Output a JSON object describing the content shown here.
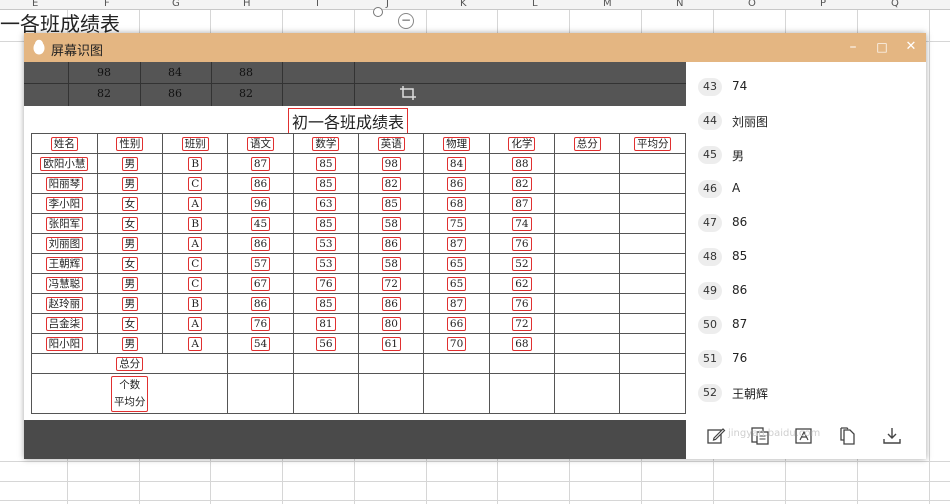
{
  "sheet": {
    "columns": [
      "E",
      "F",
      "G",
      "H",
      "I",
      "J",
      "K",
      "L",
      "M",
      "N",
      "O",
      "P",
      "Q"
    ],
    "title_partial": "一各班成绩表",
    "left_edge_values": [
      "数学",
      "85",
      "85",
      "63",
      "85",
      "53",
      "76",
      "85",
      "81",
      "56"
    ]
  },
  "window": {
    "title": "屏幕识图",
    "buttons": {
      "minimize": "–",
      "maximize": "□",
      "close": "✕"
    }
  },
  "strip": {
    "row1": [
      "98",
      "84",
      "88"
    ],
    "row2": [
      "82",
      "86",
      "82"
    ]
  },
  "doc": {
    "title": "初一各班成绩表",
    "headers": [
      "姓名",
      "性别",
      "班别",
      "语文",
      "数学",
      "英语",
      "物理",
      "化学",
      "总分",
      "平均分"
    ],
    "rows": [
      [
        "欧阳小慧",
        "男",
        "B",
        "87",
        "85",
        "98",
        "84",
        "88"
      ],
      [
        "阳丽琴",
        "男",
        "C",
        "86",
        "85",
        "82",
        "86",
        "82"
      ],
      [
        "李小阳",
        "女",
        "A",
        "96",
        "63",
        "85",
        "68",
        "87"
      ],
      [
        "张阳军",
        "女",
        "B",
        "45",
        "85",
        "58",
        "75",
        "74"
      ],
      [
        "刘丽图",
        "男",
        "A",
        "86",
        "53",
        "86",
        "87",
        "76"
      ],
      [
        "王朝辉",
        "女",
        "C",
        "57",
        "53",
        "58",
        "65",
        "52"
      ],
      [
        "冯慧聪",
        "男",
        "C",
        "67",
        "76",
        "72",
        "65",
        "62"
      ],
      [
        "赵玲丽",
        "男",
        "B",
        "86",
        "85",
        "86",
        "87",
        "76"
      ],
      [
        "吕金柒",
        "女",
        "A",
        "76",
        "81",
        "80",
        "66",
        "72"
      ],
      [
        "阳小阳",
        "男",
        "A",
        "54",
        "56",
        "61",
        "70",
        "68"
      ]
    ],
    "footer": {
      "total": "总分",
      "count": "个数",
      "average": "平均分"
    }
  },
  "results": [
    {
      "index": "43",
      "text": "74"
    },
    {
      "index": "44",
      "text": "刘丽图"
    },
    {
      "index": "45",
      "text": "男"
    },
    {
      "index": "46",
      "text": "A"
    },
    {
      "index": "47",
      "text": "86"
    },
    {
      "index": "48",
      "text": "85"
    },
    {
      "index": "49",
      "text": "86"
    },
    {
      "index": "50",
      "text": "87"
    },
    {
      "index": "51",
      "text": "76"
    },
    {
      "index": "52",
      "text": "王朝辉"
    }
  ],
  "toolbar": {
    "icons": [
      "edit-icon",
      "copy-text-icon",
      "translate-icon",
      "copy-icon",
      "download-icon"
    ]
  },
  "watermark": "jingyan.baidu.com",
  "colors": {
    "titlebar": "#e4b682",
    "ocr_box": "#e03030",
    "preview_bg": "#4a4a4a"
  }
}
